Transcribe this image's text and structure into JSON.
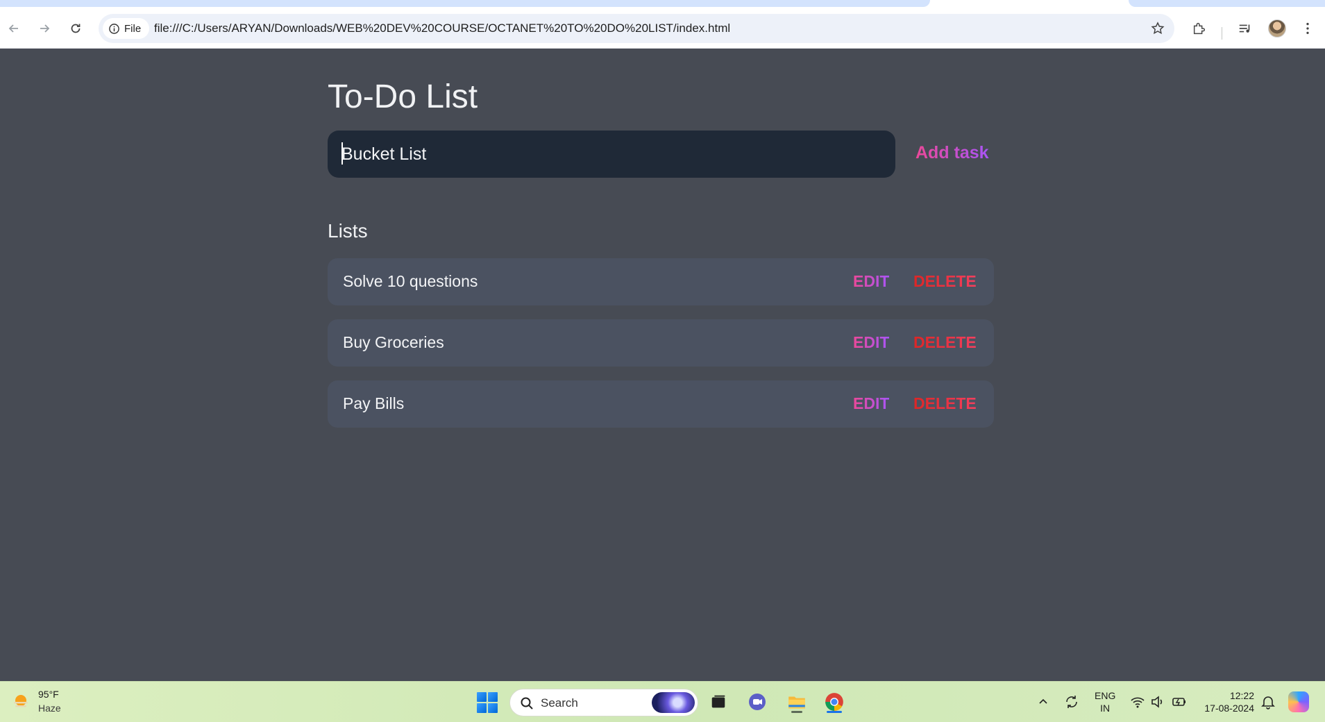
{
  "browser": {
    "site_chip": "File",
    "url": "file:///C:/Users/ARYAN/Downloads/WEB%20DEV%20COURSE/OCTANET%20TO%20DO%20LIST/index.html"
  },
  "app": {
    "title": "To-Do List",
    "input": {
      "value": "Bucket List"
    },
    "add_button": "Add task",
    "lists_heading": "Lists",
    "tasks": [
      {
        "text": "Solve 10 questions",
        "edit": "EDIT",
        "delete": "DELETE"
      },
      {
        "text": "Buy Groceries",
        "edit": "EDIT",
        "delete": "DELETE"
      },
      {
        "text": "Pay Bills",
        "edit": "EDIT",
        "delete": "DELETE"
      }
    ]
  },
  "taskbar": {
    "weather": {
      "temp": "95°F",
      "condition": "Haze"
    },
    "search_label": "Search",
    "language": {
      "line1": "ENG",
      "line2": "IN"
    },
    "clock": {
      "time": "12:22",
      "date": "17-08-2024"
    }
  },
  "colors": {
    "page_bg": "#474b54",
    "input_bg": "#1f2937",
    "task_bg": "#4b5261",
    "accent_pink": "#ec4899",
    "accent_purple": "#a855f7",
    "delete_red": "#dc2626"
  }
}
